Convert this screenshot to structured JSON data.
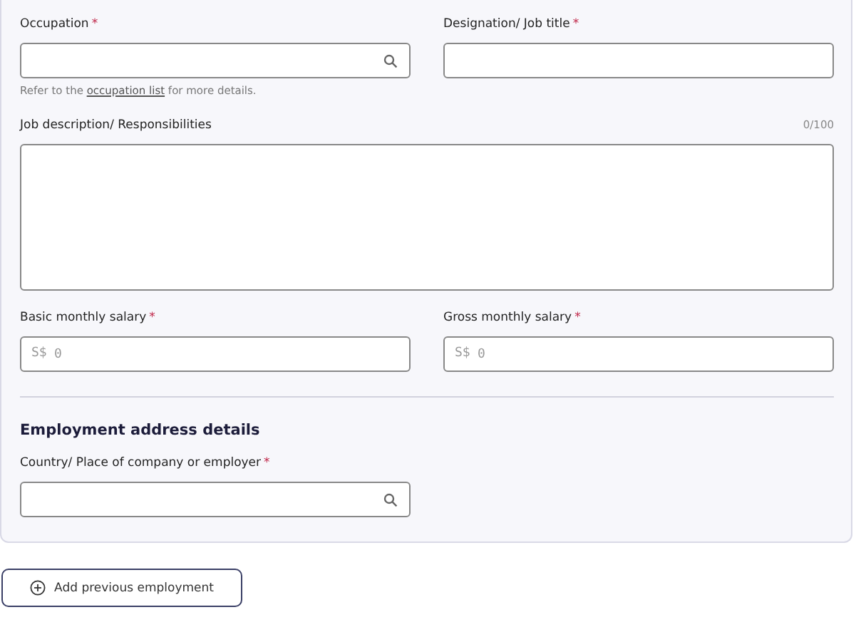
{
  "occupation": {
    "label": "Occupation",
    "required_mark": "*",
    "search": true
  },
  "designation": {
    "label": "Designation/ Job title",
    "required_mark": "*"
  },
  "occupation_hint": {
    "before": "Refer to the ",
    "link": "occupation list",
    "after": " for more details."
  },
  "job_description": {
    "label": "Job description/ Responsibilities",
    "counter": "0/100"
  },
  "basic_salary": {
    "label": "Basic monthly salary",
    "required_mark": "*",
    "prefix": "S$",
    "placeholder": "0"
  },
  "gross_salary": {
    "label": "Gross monthly salary",
    "required_mark": "*",
    "prefix": "S$",
    "placeholder": "0"
  },
  "address_section": {
    "heading": "Employment address details"
  },
  "country": {
    "label": "Country/ Place of company or employer",
    "required_mark": "*",
    "search": true
  },
  "add_button": {
    "label": "Add previous employment"
  }
}
